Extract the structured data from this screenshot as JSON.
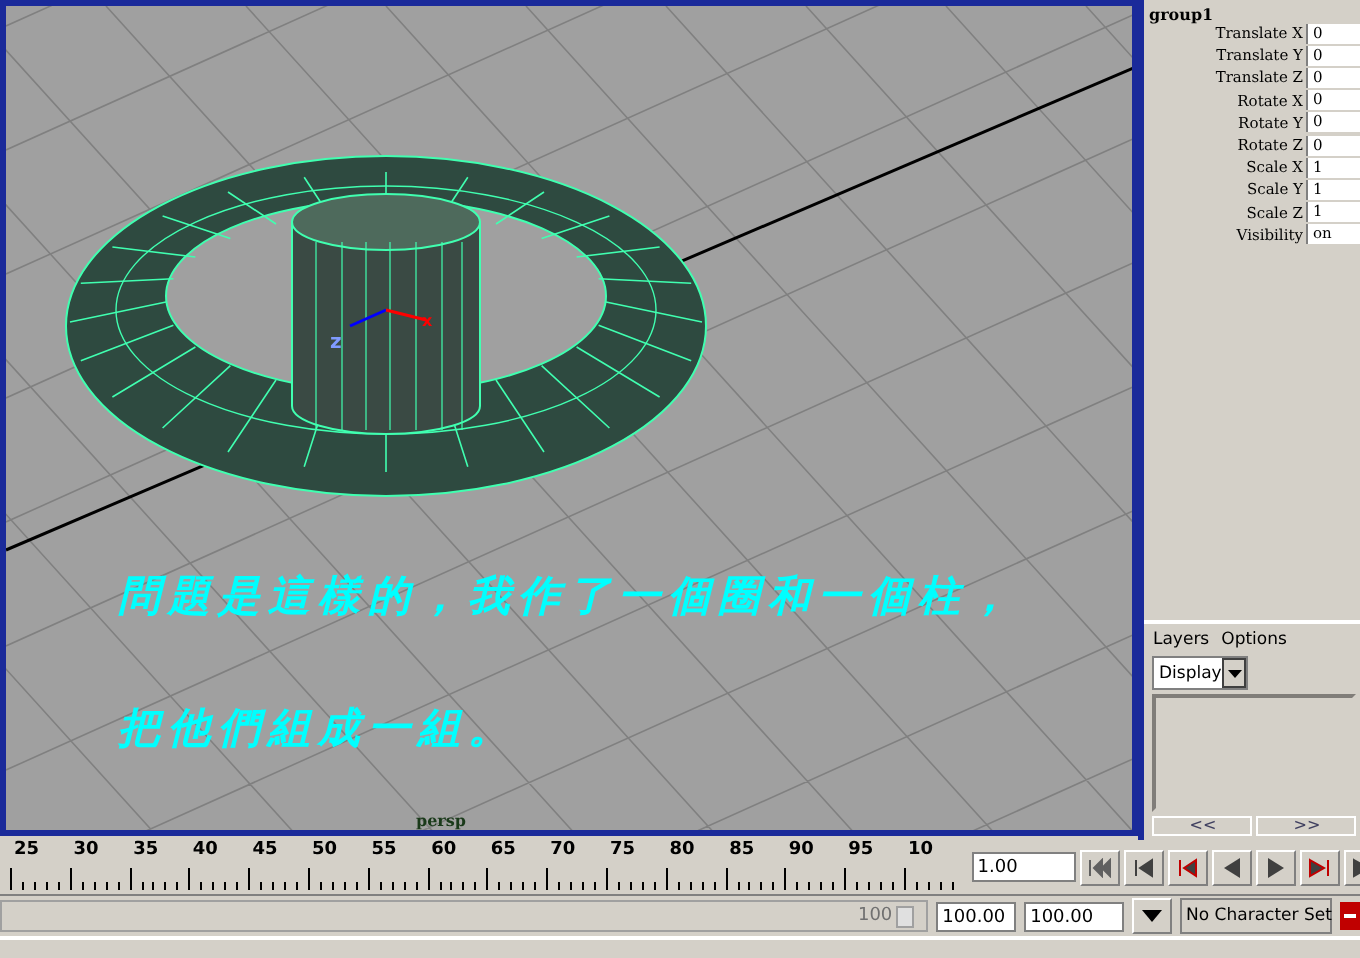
{
  "viewport": {
    "caption_lines": [
      "問題是這樣的，我作了一個圈和一個柱，",
      "把他們組成一組。"
    ],
    "axis_labels": [
      "z",
      "x"
    ],
    "camera_label": "persp"
  },
  "channel_box": {
    "title": "group1",
    "channels": [
      {
        "label": "Translate X",
        "value": "0"
      },
      {
        "label": "Translate Y",
        "value": "0"
      },
      {
        "label": "Translate Z",
        "value": "0"
      },
      {
        "label": "Rotate X",
        "value": "0"
      },
      {
        "label": "Rotate Y",
        "value": "0"
      },
      {
        "label": "Rotate Z",
        "value": "0"
      },
      {
        "label": "Scale X",
        "value": "1"
      },
      {
        "label": "Scale Y",
        "value": "1"
      },
      {
        "label": "Scale Z",
        "value": "1"
      },
      {
        "label": "Visibility",
        "value": "on"
      }
    ]
  },
  "layers": {
    "menu": [
      "Layers",
      "Options"
    ],
    "display": "Display",
    "buttons": [
      "<<",
      ">>"
    ]
  },
  "timeline": {
    "ticks": [
      "25",
      "30",
      "35",
      "40",
      "45",
      "50",
      "55",
      "60",
      "65",
      "70",
      "75",
      "80",
      "85",
      "90",
      "95",
      "10"
    ],
    "current_frame": "1.00"
  },
  "range": {
    "slider_value": "100",
    "start": "100.00",
    "end": "100.00",
    "character_set": "No Character Set"
  }
}
